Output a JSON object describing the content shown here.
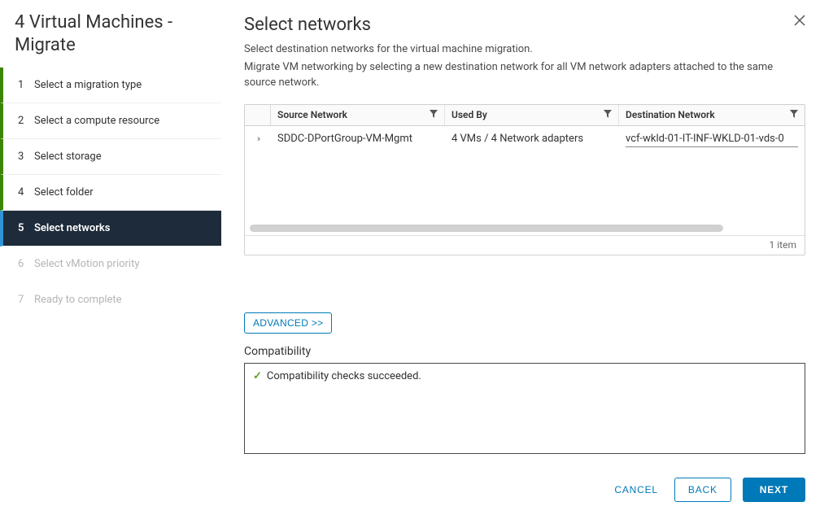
{
  "wizard": {
    "title": "4 Virtual Machines - Migrate",
    "steps": [
      {
        "num": "1",
        "label": "Select a migration type",
        "state": "completed"
      },
      {
        "num": "2",
        "label": "Select a compute resource",
        "state": "completed"
      },
      {
        "num": "3",
        "label": "Select storage",
        "state": "completed"
      },
      {
        "num": "4",
        "label": "Select folder",
        "state": "completed"
      },
      {
        "num": "5",
        "label": "Select networks",
        "state": "active"
      },
      {
        "num": "6",
        "label": "Select vMotion priority",
        "state": "disabled"
      },
      {
        "num": "7",
        "label": "Ready to complete",
        "state": "disabled"
      }
    ]
  },
  "page": {
    "title": "Select networks",
    "desc1": "Select destination networks for the virtual machine migration.",
    "desc2": "Migrate VM networking by selecting a new destination network for all VM network adapters attached to the same source network."
  },
  "table": {
    "columns": {
      "source": "Source Network",
      "usedBy": "Used By",
      "dest": "Destination Network"
    },
    "row": {
      "source": "SDDC-DPortGroup-VM-Mgmt",
      "usedBy": "4 VMs / 4 Network adapters",
      "dest": "vcf-wkld-01-IT-INF-WKLD-01-vds-0"
    },
    "footer": "1 item"
  },
  "advanced_label": "ADVANCED >>",
  "compat": {
    "heading": "Compatibility",
    "message": "Compatibility checks succeeded."
  },
  "buttons": {
    "cancel": "CANCEL",
    "back": "BACK",
    "next": "NEXT"
  }
}
